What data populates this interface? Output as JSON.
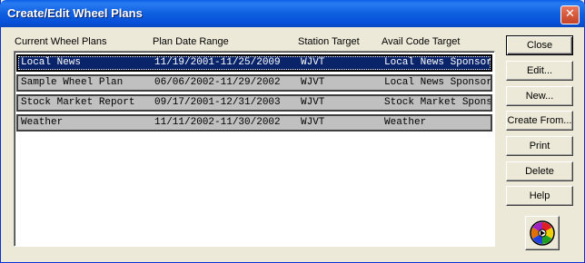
{
  "window": {
    "title": "Create/Edit Wheel Plans",
    "close_glyph": "✕"
  },
  "columns": {
    "plan": "Current Wheel Plans",
    "date_range": "Plan Date Range",
    "station": "Station Target",
    "avail": "Avail Code Target"
  },
  "plans": [
    {
      "name": "Local News",
      "date_range": "11/19/2001-11/25/2009",
      "station": "WJVT",
      "avail": "Local News Sponsor",
      "selected": true
    },
    {
      "name": "Sample Wheel Plan",
      "date_range": "06/06/2002-11/29/2002",
      "station": "WJVT",
      "avail": "Local News Sponsor",
      "selected": false
    },
    {
      "name": "Stock Market Report",
      "date_range": "09/17/2001-12/31/2003",
      "station": "WJVT",
      "avail": "Stock Market Spons",
      "selected": false
    },
    {
      "name": "Weather",
      "date_range": "11/11/2002-11/30/2002",
      "station": "WJVT",
      "avail": "Weather",
      "selected": false
    }
  ],
  "buttons": {
    "close": "Close",
    "edit": "Edit...",
    "new": "New...",
    "create_from": "Create From...",
    "print": "Print",
    "delete": "Delete",
    "help": "Help"
  },
  "icons": {
    "wheel": "wheel-icon",
    "close": "close-icon"
  },
  "colors": {
    "title_bar": "#0a5fe6",
    "selection": "#0a246a",
    "row_fill": "#c0c0c0",
    "dialog_bg": "#ece9d8"
  }
}
